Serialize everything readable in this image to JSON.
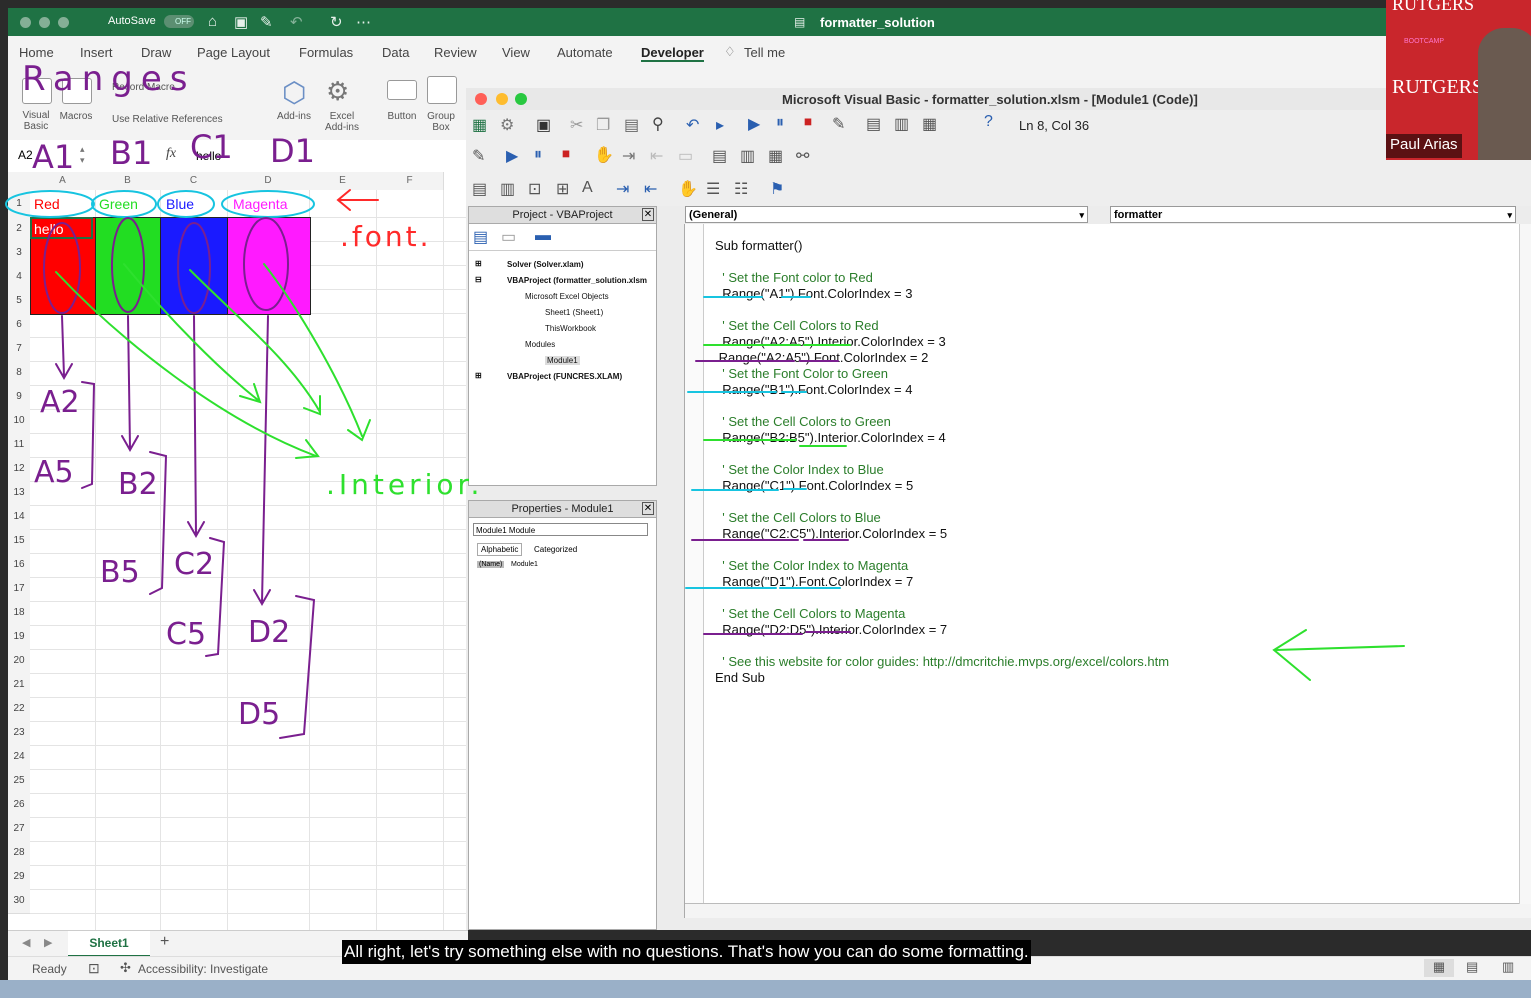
{
  "excel": {
    "autosave": "AutoSave",
    "autosave_state": "OFF",
    "doc_title": "formatter_solution",
    "tabs": [
      "Home",
      "Insert",
      "Draw",
      "Page Layout",
      "Formulas",
      "Data",
      "Review",
      "View",
      "Automate",
      "Developer",
      "Tell me"
    ],
    "active_tab": "Developer",
    "ribbon": {
      "visual_basic": "Visual Basic",
      "macros": "Macros",
      "record_macro": "Record Macro",
      "use_relative": "Use Relative References",
      "addins": "Add-ins",
      "excel_addins": "Excel Add-ins",
      "button": "Button",
      "group_box": "Group Box"
    },
    "name_box": "A2",
    "fx": "fx",
    "formula_value": "hello",
    "columns": [
      "A",
      "B",
      "C",
      "D",
      "E",
      "F"
    ],
    "rows": [
      "1",
      "2",
      "3",
      "4",
      "5",
      "6",
      "7",
      "8",
      "9",
      "10",
      "11",
      "12",
      "13",
      "14",
      "15",
      "16",
      "17",
      "18",
      "19",
      "20",
      "21",
      "22",
      "23",
      "24",
      "25",
      "26",
      "27",
      "28",
      "29",
      "30"
    ],
    "cells": {
      "a1": "Red",
      "b1": "Green",
      "c1": "Blue",
      "d1": "Magenta",
      "a2": "hello"
    },
    "sheet_tab": "Sheet1",
    "add_sheet": "+",
    "status_ready": "Ready",
    "status_accessibility": "Accessibility: Investigate"
  },
  "vbe": {
    "title": "Microsoft Visual Basic - formatter_solution.xlsm - [Module1 (Code)]",
    "cursor_pos": "Ln 8, Col 36",
    "project_title": "Project - VBAProject",
    "tree": [
      "Solver (Solver.xlam)",
      "VBAProject (formatter_solution.xlsm",
      "Microsoft Excel Objects",
      "Sheet1 (Sheet1)",
      "ThisWorkbook",
      "Modules",
      "Module1",
      "VBAProject (FUNCRES.XLAM)"
    ],
    "properties_title": "Properties - Module1",
    "properties_object": "Module1  Module",
    "prop_tabs": [
      "Alphabetic",
      "Categorized"
    ],
    "prop_name_key": "(Name)",
    "prop_name_val": "Module1",
    "proc_general": "(General)",
    "proc_name": "formatter",
    "code": [
      "Sub formatter()",
      "",
      "  ' Set the Font color to Red",
      "  Range(\"A1\").Font.ColorIndex = 3",
      "",
      "  ' Set the Cell Colors to Red",
      "  Range(\"A2:A5\").Interior.ColorIndex = 3",
      " Range(\"A2:A5\").Font.ColorIndex = 2",
      "  ' Set the Font Color to Green",
      "  Range(\"B1\").Font.ColorIndex = 4",
      "",
      "  ' Set the Cell Colors to Green",
      "  Range(\"B2:B5\").Interior.ColorIndex = 4",
      "",
      "  ' Set the Color Index to Blue",
      "  Range(\"C1\").Font.ColorIndex = 5",
      "",
      "  ' Set the Cell Colors to Blue",
      "  Range(\"C2:C5\").Interior.ColorIndex = 5",
      "",
      "  ' Set the Color Index to Magenta",
      "  Range(\"D1\").Font.ColorIndex = 7",
      "",
      "  ' Set the Cell Colors to Magenta",
      "  Range(\"D2:D5\").Interior.ColorIndex = 7",
      "",
      "  ' See this website for color guides: http://dmcritchie.mvps.org/excel/colors.htm",
      "End Sub"
    ]
  },
  "webcam": {
    "brand": "RUTGERS",
    "brand_small": "BOOTCAMP",
    "name": "Paul Arias"
  },
  "annotations": {
    "ranges": "Ranges",
    "a1": "A1",
    "b1": "B1",
    "c1": "C1",
    "d1": "D1",
    "font": ".font.",
    "interior": ".Interior.",
    "a2": "A2",
    "a5": "A5",
    "b2": "B2",
    "b5": "B5",
    "c2": "C2",
    "c5": "C5",
    "d2": "D2",
    "d5": "D5"
  },
  "subtitle": "All right, let's try something else with no questions. That's how you can do some formatting.",
  "colors": {
    "excel_green": "#1f7244",
    "red": "#ff0000",
    "green": "#00ff00",
    "blue": "#0000ff",
    "magenta": "#ff00ff",
    "comment": "#2a7d2a",
    "ink_purple": "#7a1f8f",
    "ink_cyan": "#17c4e0",
    "ink_green": "#2ee02e",
    "ink_red": "#ff2a2a"
  }
}
